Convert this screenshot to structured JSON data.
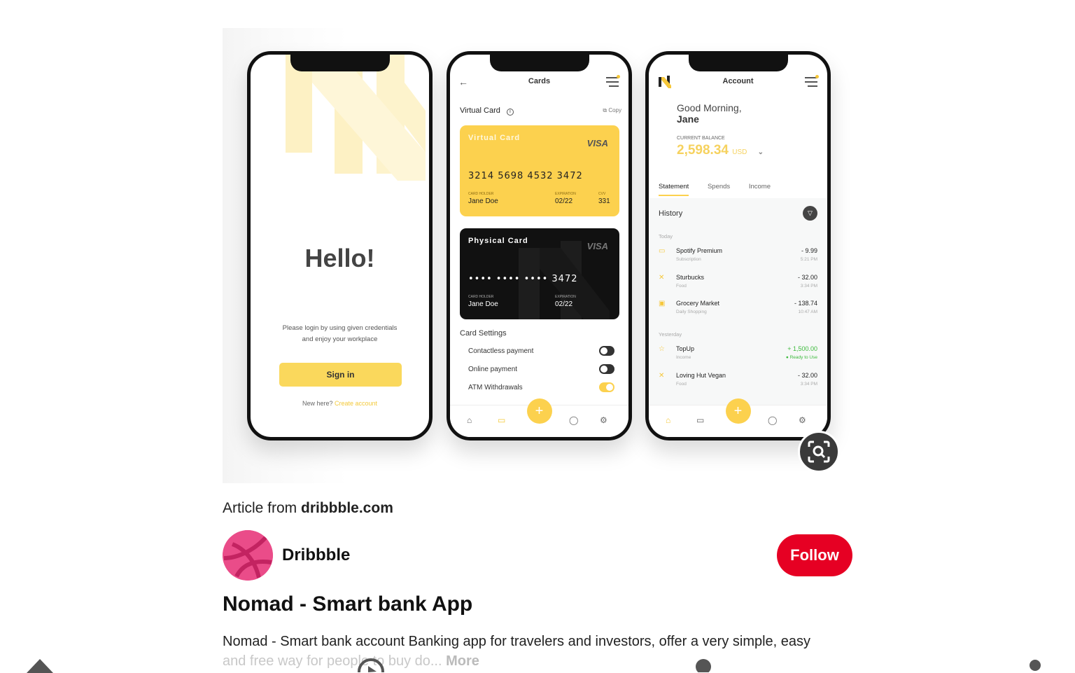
{
  "phone1": {
    "hello": "Hello!",
    "subtitle_line1": "Please login by using given credentials",
    "subtitle_line2": "and enjoy your workplace",
    "signin_label": "Sign in",
    "new_here": "New here?",
    "create_account": "Create account"
  },
  "phone2": {
    "title": "Cards",
    "virtual_card_header": "Virtual Card",
    "copy_label": "Copy",
    "virtual_card": {
      "name": "Virtual Card",
      "brand": "VISA",
      "number": "3214 5698 4532 3472",
      "holder_label": "CARD HOLDER",
      "holder": "Jane Doe",
      "exp_label": "EXPIRATION",
      "exp": "02/22",
      "cvv_label": "CVV",
      "cvv": "331"
    },
    "physical_card": {
      "name": "Physical Card",
      "brand": "VISA",
      "number": "•••• •••• •••• 3472",
      "holder_label": "CARD HOLDER",
      "holder": "Jane Doe",
      "exp_label": "EXPIRATION",
      "exp": "02/22"
    },
    "card_settings_title": "Card Settings",
    "settings": [
      {
        "label": "Contactless payment",
        "on": false
      },
      {
        "label": "Online payment",
        "on": false
      },
      {
        "label": "ATM Withdrawals",
        "on": true
      }
    ]
  },
  "phone3": {
    "title": "Account",
    "greeting_line1": "Good Morning,",
    "greeting_line2": "Jane",
    "balance_label": "CURRENT BALANCE",
    "balance": "2,598.34",
    "currency": "USD",
    "tabs": [
      "Statement",
      "Spends",
      "Income"
    ],
    "history_title": "History",
    "today_label": "Today",
    "yesterday_label": "Yesterday",
    "transactions_today": [
      {
        "name": "Spotify Premium",
        "category": "Subscription",
        "amount": "- 9.99",
        "time": "5:21 PM"
      },
      {
        "name": "Sturbucks",
        "category": "Food",
        "amount": "- 32.00",
        "time": "3:34 PM"
      },
      {
        "name": "Grocery Market",
        "category": "Daily Shopping",
        "amount": "- 138.74",
        "time": "10:47 AM"
      }
    ],
    "transactions_yesterday": [
      {
        "name": "TopUp",
        "category": "Income",
        "amount": "+ 1,500.00",
        "time": "● Ready to Use"
      },
      {
        "name": "Loving Hut Vegan",
        "category": "Food",
        "amount": "- 32.00",
        "time": "3:34 PM"
      }
    ]
  },
  "article": {
    "from_prefix": "Article from ",
    "source": "dribbble.com"
  },
  "author": {
    "name": "Dribbble",
    "follow_label": "Follow"
  },
  "pin": {
    "title": "Nomad - Smart bank App",
    "description_line1": "Nomad - Smart bank account Banking app for travelers and investors, offer a very simple, easy",
    "description_line2": "and free way for people to buy do...",
    "more_label": "More"
  },
  "colors": {
    "accent_yellow": "#fcd14e",
    "follow_red": "#e60023",
    "dribbble_pink": "#ea4c89"
  }
}
